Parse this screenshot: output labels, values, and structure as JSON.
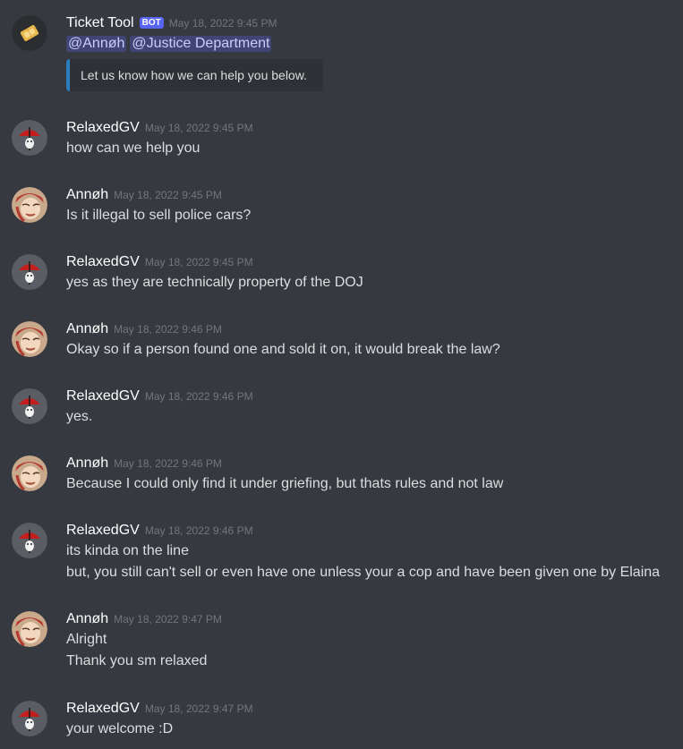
{
  "bot_message": {
    "username": "Ticket Tool",
    "bot_badge": "BOT",
    "timestamp": "May 18, 2022 9:45 PM",
    "mentions": [
      "@Annøh",
      "@Justice Department"
    ],
    "embed_text": "Let us know how we can help you below."
  },
  "messages": [
    {
      "username": "RelaxedGV",
      "timestamp": "May 18, 2022 9:45 PM",
      "avatar": "umbrella-avatar",
      "lines": [
        "how can we help you"
      ]
    },
    {
      "username": "Annøh",
      "timestamp": "May 18, 2022 9:45 PM",
      "avatar": "anime-avatar",
      "lines": [
        "Is it illegal to sell police cars?"
      ]
    },
    {
      "username": "RelaxedGV",
      "timestamp": "May 18, 2022 9:45 PM",
      "avatar": "umbrella-avatar",
      "lines": [
        "yes as they are technically property of the DOJ"
      ]
    },
    {
      "username": "Annøh",
      "timestamp": "May 18, 2022 9:46 PM",
      "avatar": "anime-avatar",
      "lines": [
        "Okay so if a person found one and sold it on, it would break the law?"
      ]
    },
    {
      "username": "RelaxedGV",
      "timestamp": "May 18, 2022 9:46 PM",
      "avatar": "umbrella-avatar",
      "lines": [
        "yes."
      ]
    },
    {
      "username": "Annøh",
      "timestamp": "May 18, 2022 9:46 PM",
      "avatar": "anime-avatar",
      "lines": [
        "Because I could only find it under griefing, but thats rules and not law"
      ]
    },
    {
      "username": "RelaxedGV",
      "timestamp": "May 18, 2022 9:46 PM",
      "avatar": "umbrella-avatar",
      "lines": [
        "its kinda on the line",
        "but, you still can't sell or even have one unless your a cop and have been given one by Elaina"
      ]
    },
    {
      "username": "Annøh",
      "timestamp": "May 18, 2022 9:47 PM",
      "avatar": "anime-avatar",
      "lines": [
        "Alright",
        "Thank you sm relaxed"
      ]
    },
    {
      "username": "RelaxedGV",
      "timestamp": "May 18, 2022 9:47 PM",
      "avatar": "umbrella-avatar",
      "lines": [
        "your welcome :D"
      ]
    }
  ]
}
